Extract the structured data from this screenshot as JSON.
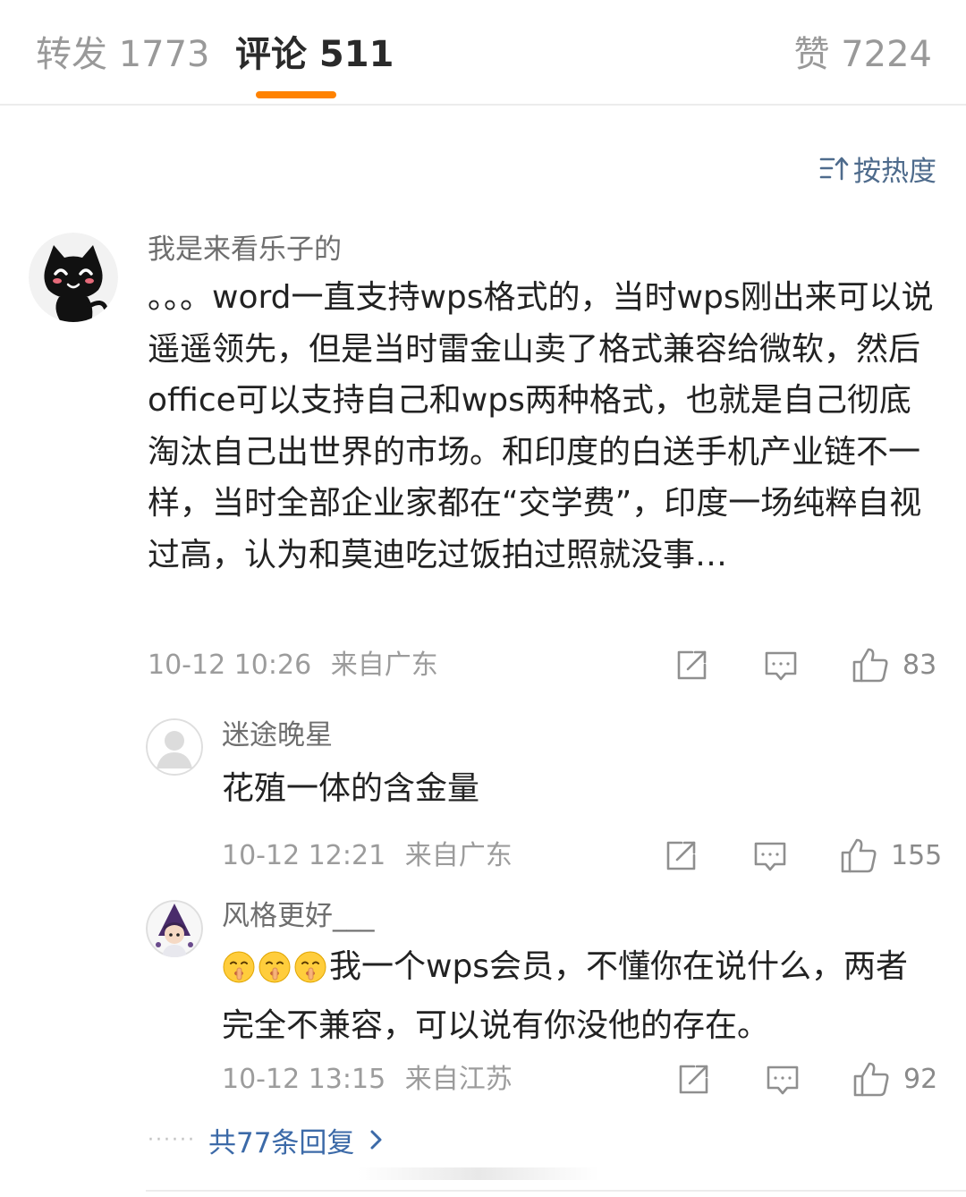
{
  "tabs": {
    "repost": "转发 1773",
    "comments": "评论 511",
    "likes": "赞 7224"
  },
  "sort": {
    "label": "按热度",
    "icon": "sort-icon"
  },
  "comment": {
    "username": "我是来看乐子的",
    "text": "。。。word一直支持wps格式的，当时wps刚出来可以说遥遥领先，但是当时雷金山卖了格式兼容给微软，然后office可以支持自己和wps两种格式，也就是自己彻底淘汰自己出世界的市场。和印度的白送手机产业链不一样，当时全部企业家都在“交学费”，印度一场纯粹自视过高，认为和莫迪吃过饭拍过照就没事…",
    "time": "10-12 10:26",
    "location": "来自广东",
    "likes": "83"
  },
  "replies": [
    {
      "username": "迷途晚星",
      "text": "花殖一体的含金量",
      "time": "10-12 12:21",
      "location": "来自广东",
      "likes": "155"
    },
    {
      "username": "风格更好___",
      "emoji": "shushing-face-emoji",
      "text": "我一个wps会员，不懂你在说什么，两者完全不兼容，可以说有你没他的存在。",
      "time": "10-12 13:15",
      "location": "来自江苏",
      "likes": "92"
    }
  ],
  "more_replies": {
    "label": "共77条回复"
  },
  "colors": {
    "accent": "#ff8200",
    "link": "#3c6aa8",
    "sort": "#4e6b8c",
    "muted": "#9c9c9c"
  }
}
